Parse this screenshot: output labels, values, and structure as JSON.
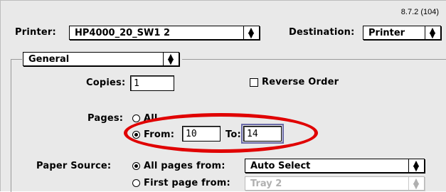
{
  "header": {
    "version": "8.7.2 (104)",
    "printer_label": "Printer:",
    "printer_value": "HP4000_20_SW1 2",
    "destination_label": "Destination:",
    "destination_value": "Printer"
  },
  "section_popup": {
    "value": "General"
  },
  "copies": {
    "label": "Copies:",
    "value": "1"
  },
  "reverse_order": {
    "label": "Reverse Order",
    "checked": false
  },
  "pages": {
    "label": "Pages:",
    "all_label": "All",
    "from_label": "From:",
    "from_value": "10",
    "to_label": "To:",
    "to_value": "14",
    "selected": "from"
  },
  "paper_source": {
    "label": "Paper Source:",
    "all_pages_label": "All pages from:",
    "all_pages_value": "Auto Select",
    "first_page_label": "First page from:",
    "first_page_value": "Tray 2",
    "selected": "all_pages"
  },
  "annotation_color": "#e00000",
  "popup_arrow_glyph": "⬍"
}
